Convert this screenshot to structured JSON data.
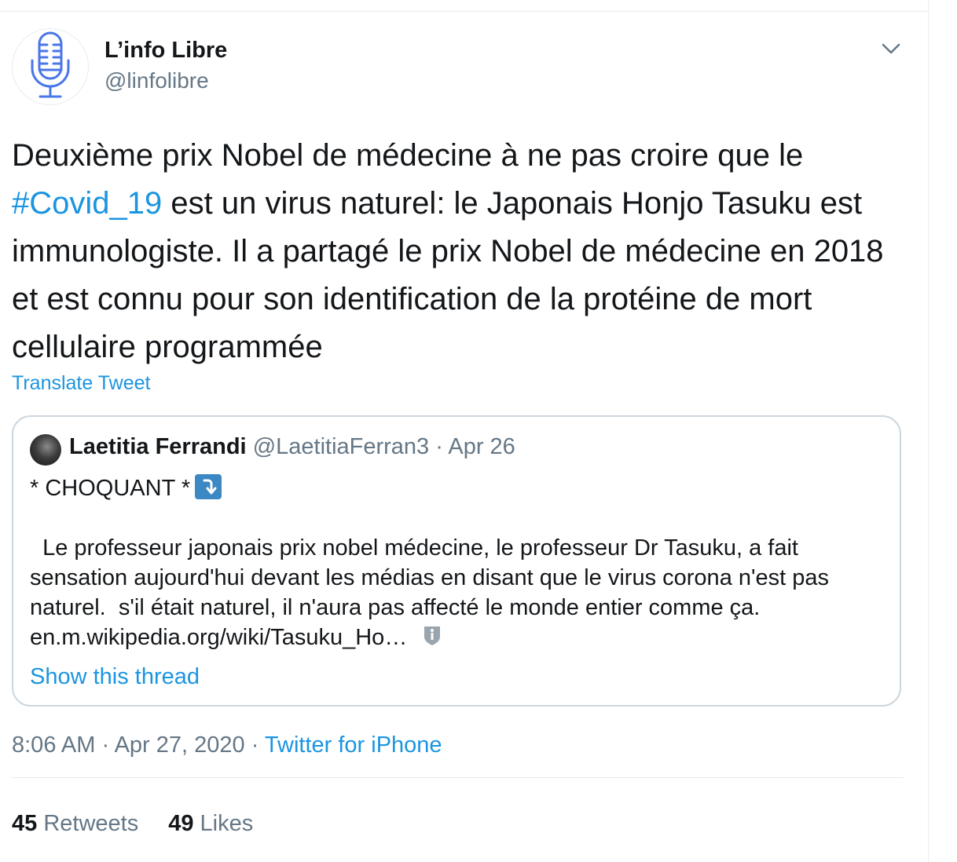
{
  "author": {
    "display_name": "L’info Libre",
    "handle": "@linfolibre",
    "avatar_icon": "microphone-icon"
  },
  "tweet": {
    "text_part1": "Deuxième prix Nobel de médecine à ne pas croire que le ",
    "hashtag": "#Covid_19",
    "text_part2": " est un virus naturel: le Japonais Honjo Tasuku est immunologiste. Il a partagé le prix Nobel de médecine en 2018 et est connu pour son identification de la protéine de mort cellulaire programmée",
    "translate_label": "Translate Tweet"
  },
  "quoted": {
    "display_name": "Laetitia Ferrandi",
    "handle": "@LaetitiaFerran3",
    "separator": " · ",
    "date": "Apr 26",
    "line1": "* CHOQUANT *",
    "line2": "  Le professeur japonais prix nobel médecine, le professeur Dr Tasuku, a fait",
    "line3": "sensation aujourd'hui devant les médias en disant que le virus corona n'est pas",
    "line4": "naturel.  s'il était naturel, il n'aura pas affecté le monde entier comme ça.",
    "link": "en.m.wikipedia.org/wiki/Tasuku_Ho…",
    "show_thread": "Show this thread"
  },
  "meta": {
    "time": "8:06 AM",
    "sep1": " · ",
    "date": "Apr 27, 2020",
    "sep2": " · ",
    "source": "Twitter for iPhone"
  },
  "stats": {
    "retweets_count": "45",
    "retweets_label": "Retweets",
    "likes_count": "49",
    "likes_label": "Likes"
  },
  "colors": {
    "link_blue": "#1b95e0",
    "secondary_text": "#657786",
    "primary_text": "#14171a",
    "border": "#ccd6dd"
  }
}
